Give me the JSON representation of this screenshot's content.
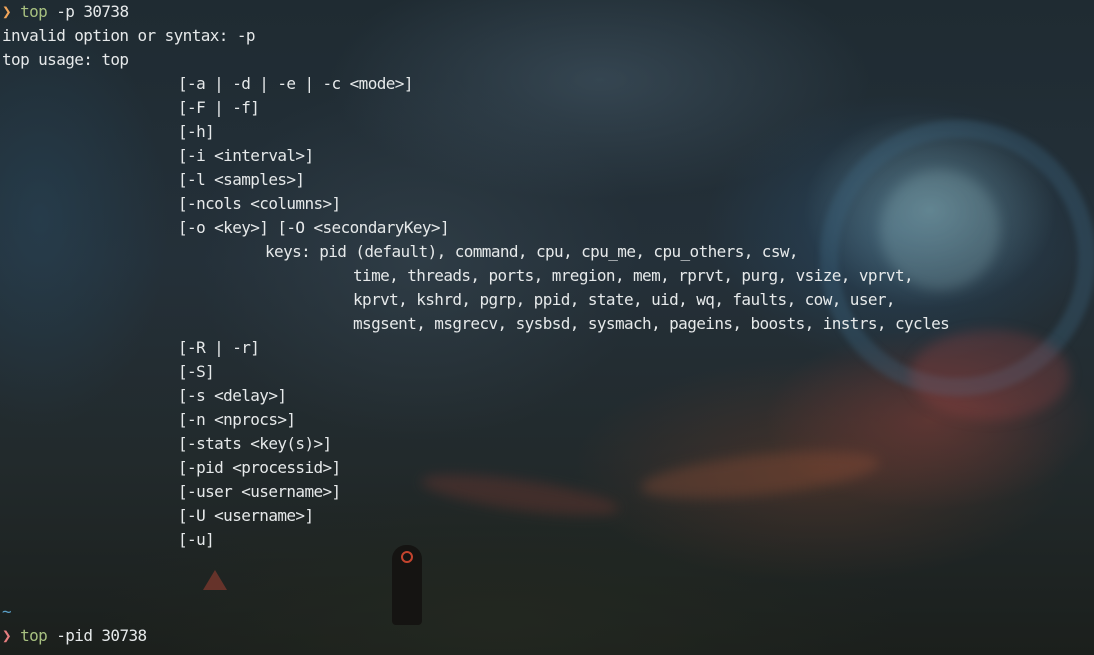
{
  "terminal": {
    "first_command": {
      "prompt_symbol": "❯",
      "program": "top",
      "args": " -p 30738"
    },
    "error_lines": [
      "invalid option or syntax: -p",
      "top usage: top"
    ],
    "usage_options": [
      "[-a | -d | -e | -c <mode>]",
      "[-F | -f]",
      "[-h]",
      "[-i <interval>]",
      "[-l <samples>]",
      "[-ncols <columns>]",
      "[-o <key>] [-O <secondaryKey>]"
    ],
    "keys_line": "keys: pid (default), command, cpu, cpu_me, cpu_others, csw,",
    "keys_continuation": [
      "time, threads, ports, mregion, mem, rprvt, purg, vsize, vprvt,",
      "kprvt, kshrd, pgrp, ppid, state, uid, wq, faults, cow, user,",
      "msgsent, msgrecv, sysbsd, sysmach, pageins, boosts, instrs, cycles"
    ],
    "usage_options_2": [
      "[-R | -r]",
      "[-S]",
      "[-s <delay>]",
      "[-n <nprocs>]",
      "[-stats <key(s)>]",
      "[-pid <processid>]",
      "[-user <username>]",
      "[-U <username>]",
      "[-u]"
    ],
    "tilde": "~",
    "second_command": {
      "prompt_symbol": "❯",
      "program": "top",
      "args": " -pid 30738"
    }
  },
  "colors": {
    "prompt_ok": "#f2a65a",
    "prompt_error": "#e67e80",
    "command": "#a7c080",
    "path_tilde": "#5aa0c8",
    "text": "#e6e9ea"
  }
}
